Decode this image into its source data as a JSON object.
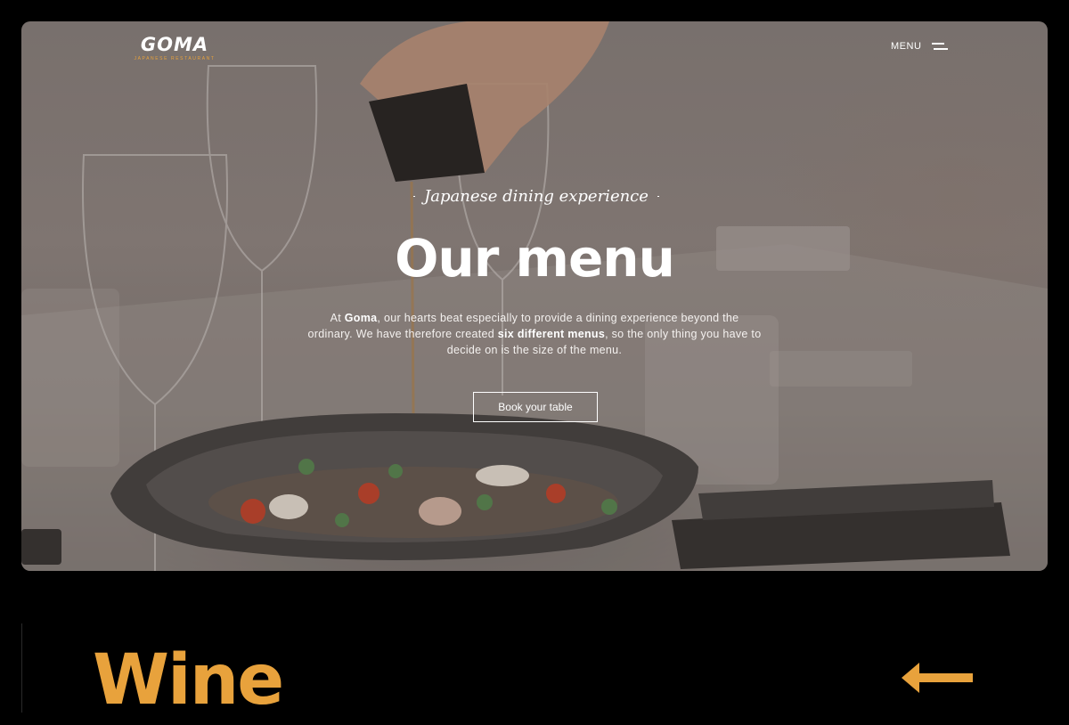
{
  "header": {
    "logo_text": "GOMA",
    "logo_subtitle": "JAPANESE RESTAURANT",
    "menu_label": "MENU"
  },
  "hero": {
    "tagline": "Japanese dining experience",
    "title": "Our menu",
    "description_parts": {
      "p1": "At ",
      "brand": "Goma",
      "p2": ", our hearts beat especially to provide a dining experience beyond the ordinary. We have therefore created ",
      "highlight": "six different menus",
      "p3": ", so the only thing you have to decide on is the size of the menu."
    },
    "cta_label": "Book your table"
  },
  "section": {
    "title": "Wine"
  },
  "icons": {
    "menu": "hamburger-icon",
    "back": "arrow-left-icon"
  },
  "colors": {
    "background": "#000000",
    "accent": "#e8a23c",
    "text_light": "#ffffff"
  }
}
